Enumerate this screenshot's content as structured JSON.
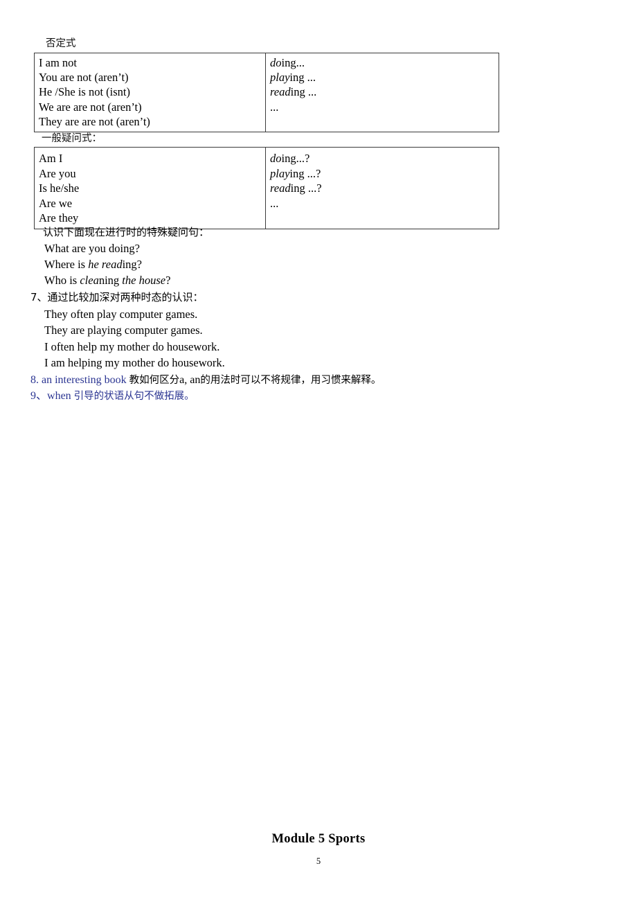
{
  "document": {
    "page_number": "5",
    "footer_title": "Module 5  Sports"
  },
  "sections": [
    {
      "heading": "否定式",
      "table": {
        "left_column": [
          "I am not",
          "You are not (aren’t)",
          "He /She is not (isnt)",
          "We are are not (aren’t)",
          "They are are not (aren’t)"
        ],
        "right_column": [
          {
            "stem": "do",
            "suffix": "ing..."
          },
          {
            "stem": "play",
            "suffix": "ing ..."
          },
          {
            "stem": "read",
            "suffix": "ing ..."
          },
          {
            "stem": "",
            "suffix": "..."
          }
        ]
      }
    },
    {
      "heading": "一般疑问式：",
      "table": {
        "left_column": [
          "Am I",
          "Are you",
          "Is he/she",
          "Are we",
          "Are they"
        ],
        "right_column": [
          {
            "stem": "do",
            "suffix": "ing...?"
          },
          {
            "stem": "play",
            "suffix": "ing ...?"
          },
          {
            "stem": "read",
            "suffix": "ing ...?"
          },
          {
            "stem": "",
            "suffix": "..."
          }
        ]
      }
    }
  ],
  "notes": {
    "wh_questions_heading": "认识下面现在进行时的特殊疑问句：",
    "wh_questions": [
      {
        "plain1": "What are you doing?",
        "italic": "",
        "plain2": ""
      },
      {
        "plain1": "Where is ",
        "italic": "he read",
        "plain2": "ing?"
      },
      {
        "plain1": "Who is ",
        "italic": "clea",
        "plain2": "ning ",
        "italic2": "the house",
        "plain3": "?"
      }
    ],
    "item7_heading": "7、通过比较加深对两种时态的认识：",
    "item7_examples": [
      "They often play computer games.",
      "They are playing computer games.",
      "I often help my mother do housework.",
      "I am helping my mother do housework."
    ],
    "item8": {
      "number": "8.",
      "english": "an interesting book",
      "chinese_a": "教如何区分",
      "english_mid": "a, an",
      "chinese_b": "的用法时可以不将规律，用习惯来解释。"
    },
    "item9": {
      "number": "9、",
      "english": "when",
      "chinese": "引导的状语从句不做拓展。"
    }
  },
  "colors": {
    "blue_text": "#2b3592",
    "table_border": "#3a3a3a",
    "body_text": "#000000"
  }
}
